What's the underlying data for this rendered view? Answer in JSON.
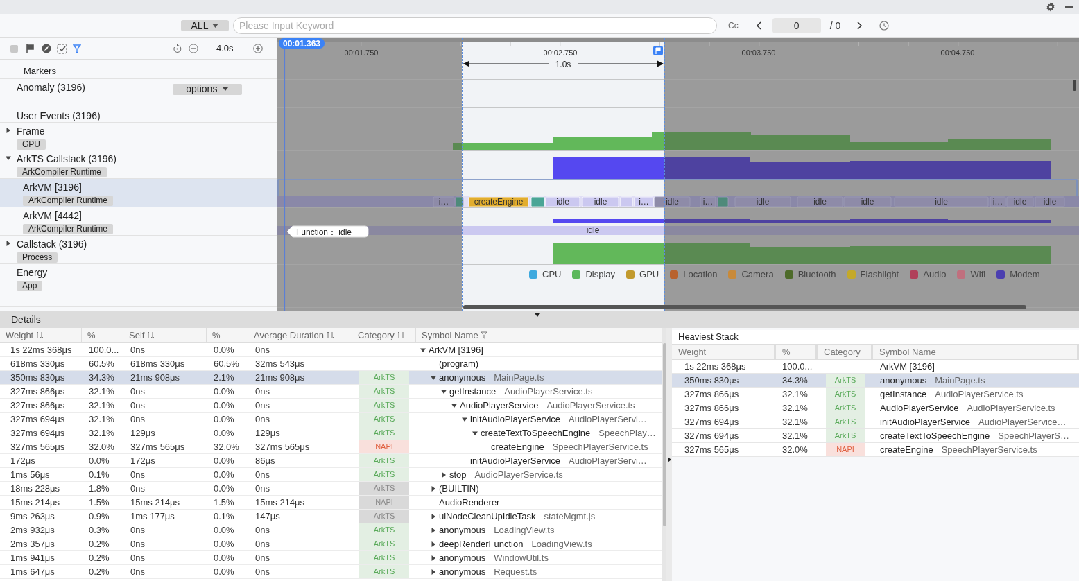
{
  "header": {
    "filter_dropdown": "ALL",
    "search": {
      "placeholder": "Please Input Keyword"
    },
    "case_button": "Cc",
    "match_index": "0",
    "match_total": "/ 0"
  },
  "timeline_toolbar": {
    "zoom_level": "4.0s"
  },
  "tracks": [
    {
      "name": "Markers",
      "selected": false
    },
    {
      "name": "Anomaly (3196)",
      "dropdown": "options",
      "selected": false
    },
    {
      "name": "User Events (3196)",
      "selected": false
    },
    {
      "name": "Frame",
      "tag": "GPU",
      "expanded": false,
      "selected": false
    },
    {
      "name": "ArkTS Callstack (3196)",
      "tag": "ArkCompiler Runtime",
      "expanded": true,
      "selected": false,
      "children": [
        {
          "name": "ArkVM [3196]",
          "tag": "ArkCompiler Runtime",
          "selected": true
        },
        {
          "name": "ArkVM [4442]",
          "tag": "ArkCompiler Runtime",
          "selected": false
        }
      ]
    },
    {
      "name": "Callstack (3196)",
      "tag": "Process",
      "expanded": false,
      "selected": false
    },
    {
      "name": "Energy",
      "tag": "App",
      "selected": false
    }
  ],
  "timeline": {
    "cursor_time": "00:01.363",
    "ticks": [
      "00:01.750",
      "00:02.750",
      "00:03.750",
      "00:04.750"
    ],
    "selection_duration": "1.0s",
    "callstack_slices": [
      {
        "label": "i…",
        "kind": "idle"
      },
      {
        "kind": "native"
      },
      {
        "label": "createEngine",
        "kind": "engine"
      },
      {
        "kind": "native"
      },
      {
        "label": "idle",
        "kind": "idle"
      },
      {
        "label": "idle",
        "kind": "idle"
      },
      {
        "kind": "idle"
      },
      {
        "label": "i…",
        "kind": "idle"
      },
      {
        "label": "idle",
        "kind": "idle"
      },
      {
        "label": "i…",
        "kind": "idle"
      },
      {
        "kind": "native"
      },
      {
        "label": "idle",
        "kind": "idle"
      },
      {
        "label": "idle",
        "kind": "idle"
      },
      {
        "label": "idle",
        "kind": "idle"
      },
      {
        "label": "idle",
        "kind": "idle"
      },
      {
        "label": "i…",
        "kind": "idle"
      },
      {
        "label": "idle",
        "kind": "idle"
      },
      {
        "label": "idle",
        "kind": "idle"
      }
    ],
    "thread_slice": "idle",
    "tooltip": "Function： idle",
    "legend": [
      {
        "label": "CPU",
        "color": "#3fa9de"
      },
      {
        "label": "Display",
        "color": "#5cb85c"
      },
      {
        "label": "GPU",
        "color": "#c29a2e"
      },
      {
        "label": "Location",
        "color": "#b8622e"
      },
      {
        "label": "Camera",
        "color": "#c88a3a"
      },
      {
        "label": "Bluetooth",
        "color": "#4e6b2a"
      },
      {
        "label": "Flashlight",
        "color": "#c4a92a"
      },
      {
        "label": "Audio",
        "color": "#b0405a"
      },
      {
        "label": "Wifi",
        "color": "#c0707e"
      },
      {
        "label": "Modem",
        "color": "#4b3fb0"
      }
    ]
  },
  "details": {
    "title": "Details",
    "columns": [
      {
        "label": "Weight",
        "sortable": true
      },
      {
        "label": "%",
        "sortable": false
      },
      {
        "label": "Self",
        "sortable": true
      },
      {
        "label": "%",
        "sortable": false
      },
      {
        "label": "Average Duration",
        "sortable": true
      },
      {
        "label": "Category",
        "sortable": true
      },
      {
        "label": "Symbol Name",
        "sortable": false,
        "filter": true
      }
    ],
    "rows": [
      {
        "weight": "1s 22ms 368μs",
        "weight_pct": "100.0...",
        "self": "0ns",
        "self_pct": "0.0%",
        "avg": "0ns",
        "symbol": "ArkVM [3196]",
        "expanded": true,
        "selected": false,
        "children": [
          {
            "weight": "618ms 330μs",
            "weight_pct": "60.5%",
            "self": "618ms 330μs",
            "self_pct": "60.5%",
            "avg": "32ms 543μs",
            "symbol": "(program)",
            "selected": false
          },
          {
            "weight": "350ms 830μs",
            "weight_pct": "34.3%",
            "self": "21ms 908μs",
            "self_pct": "2.1%",
            "avg": "21ms 908μs",
            "category": "ArkTS",
            "symbol": "anonymous",
            "file": "MainPage.ts",
            "expanded": true,
            "selected": true,
            "children": [
              {
                "weight": "327ms 866μs",
                "weight_pct": "32.1%",
                "self": "0ns",
                "self_pct": "0.0%",
                "avg": "0ns",
                "category": "ArkTS",
                "symbol": "getInstance",
                "file": "AudioPlayerService.ts",
                "expanded": true,
                "selected": false,
                "children": [
                  {
                    "weight": "327ms 866μs",
                    "weight_pct": "32.1%",
                    "self": "0ns",
                    "self_pct": "0.0%",
                    "avg": "0ns",
                    "category": "ArkTS",
                    "symbol": "AudioPlayerService",
                    "file": "AudioPlayerService.ts",
                    "expanded": true,
                    "selected": false,
                    "children": [
                      {
                        "weight": "327ms 694μs",
                        "weight_pct": "32.1%",
                        "self": "0ns",
                        "self_pct": "0.0%",
                        "avg": "0ns",
                        "category": "ArkTS",
                        "symbol": "initAudioPlayerService",
                        "file": "AudioPlayerServi…",
                        "expanded": true,
                        "selected": false,
                        "children": [
                          {
                            "weight": "327ms 694μs",
                            "weight_pct": "32.1%",
                            "self": "129μs",
                            "self_pct": "0.0%",
                            "avg": "129μs",
                            "category": "ArkTS",
                            "symbol": "createTextToSpeechEngine",
                            "file": "SpeechPlay…",
                            "expanded": true,
                            "selected": false,
                            "children": [
                              {
                                "weight": "327ms 565μs",
                                "weight_pct": "32.0%",
                                "self": "327ms 565μs",
                                "self_pct": "32.0%",
                                "avg": "327ms 565μs",
                                "category": "NAPI",
                                "symbol": "createEngine",
                                "file": "SpeechPlayerService.ts",
                                "selected": false
                              }
                            ]
                          }
                        ]
                      },
                      {
                        "weight": "172μs",
                        "weight_pct": "0.0%",
                        "self": "172μs",
                        "self_pct": "0.0%",
                        "avg": "86μs",
                        "category": "ArkTS",
                        "symbol": "initAudioPlayerService",
                        "file": "AudioPlayerServi…",
                        "selected": false
                      }
                    ]
                  }
                ]
              },
              {
                "weight": "1ms 56μs",
                "weight_pct": "0.1%",
                "self": "0ns",
                "self_pct": "0.0%",
                "avg": "0ns",
                "category": "ArkTS",
                "symbol": "stop",
                "file": "AudioPlayerService.ts",
                "expanded": false,
                "selected": false
              }
            ]
          },
          {
            "weight": "18ms 228μs",
            "weight_pct": "1.8%",
            "self": "0ns",
            "self_pct": "0.0%",
            "avg": "0ns",
            "category": "ArkTS",
            "greyed": true,
            "symbol": "(BUILTIN)",
            "expanded": false,
            "selected": false
          },
          {
            "weight": "15ms 214μs",
            "weight_pct": "1.5%",
            "self": "15ms 214μs",
            "self_pct": "1.5%",
            "avg": "15ms 214μs",
            "category": "NAPI",
            "greyed": true,
            "symbol": "AudioRenderer",
            "selected": false
          },
          {
            "weight": "9ms 263μs",
            "weight_pct": "0.9%",
            "self": "1ms 177μs",
            "self_pct": "0.1%",
            "avg": "147μs",
            "category": "ArkTS",
            "greyed": true,
            "symbol": "uiNodeCleanUpIdleTask",
            "file": "stateMgmt.js",
            "expanded": false,
            "selected": false
          },
          {
            "weight": "2ms 932μs",
            "weight_pct": "0.3%",
            "self": "0ns",
            "self_pct": "0.0%",
            "avg": "0ns",
            "category": "ArkTS",
            "symbol": "anonymous",
            "file": "LoadingView.ts",
            "expanded": false,
            "selected": false
          },
          {
            "weight": "2ms 357μs",
            "weight_pct": "0.2%",
            "self": "0ns",
            "self_pct": "0.0%",
            "avg": "0ns",
            "category": "ArkTS",
            "symbol": "deepRenderFunction",
            "file": "LoadingView.ts",
            "expanded": false,
            "selected": false
          },
          {
            "weight": "1ms 941μs",
            "weight_pct": "0.2%",
            "self": "0ns",
            "self_pct": "0.0%",
            "avg": "0ns",
            "category": "ArkTS",
            "symbol": "anonymous",
            "file": "WindowUtil.ts",
            "expanded": false,
            "selected": false
          },
          {
            "weight": "1ms 647μs",
            "weight_pct": "0.2%",
            "self": "0ns",
            "self_pct": "0.0%",
            "avg": "0ns",
            "category": "ArkTS",
            "symbol": "anonymous",
            "file": "Request.ts",
            "expanded": false,
            "selected": false
          }
        ]
      }
    ]
  },
  "heaviest_stack": {
    "title": "Heaviest Stack",
    "columns": [
      "Weight",
      "%",
      "Category",
      "Symbol Name"
    ],
    "rows": [
      {
        "weight": "1s 22ms 368μs",
        "weight_pct": "100.0...",
        "symbol": "ArkVM [3196]",
        "selected": false
      },
      {
        "weight": "350ms 830μs",
        "weight_pct": "34.3%",
        "category": "ArkTS",
        "symbol": "anonymous",
        "file": "MainPage.ts",
        "selected": true
      },
      {
        "weight": "327ms 866μs",
        "weight_pct": "32.1%",
        "category": "ArkTS",
        "symbol": "getInstance",
        "file": "AudioPlayerService.ts",
        "selected": false
      },
      {
        "weight": "327ms 866μs",
        "weight_pct": "32.1%",
        "category": "ArkTS",
        "symbol": "AudioPlayerService",
        "file": "AudioPlayerService.ts",
        "selected": false
      },
      {
        "weight": "327ms 694μs",
        "weight_pct": "32.1%",
        "category": "ArkTS",
        "symbol": "initAudioPlayerService",
        "file": "AudioPlayerService…",
        "selected": false
      },
      {
        "weight": "327ms 694μs",
        "weight_pct": "32.1%",
        "category": "ArkTS",
        "symbol": "createTextToSpeechEngine",
        "file": "SpeechPlayerS…",
        "selected": false
      },
      {
        "weight": "327ms 565μs",
        "weight_pct": "32.0%",
        "category": "NAPI",
        "symbol": "createEngine",
        "file": "SpeechPlayerService.ts",
        "selected": false
      }
    ]
  }
}
